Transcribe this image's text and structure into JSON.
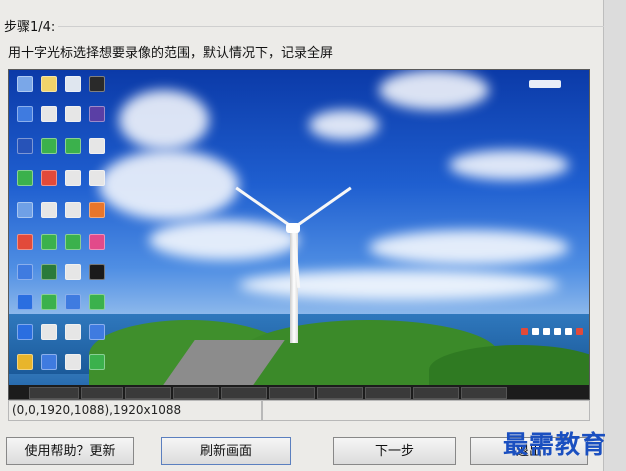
{
  "step": {
    "title": "步骤1/4:"
  },
  "instruction": "用十字光标选择想要录像的范围，默认情况下，记录全屏",
  "coordinates": "(0,0,1920,1088),1920x1088",
  "status": "",
  "buttons": {
    "help": "使用帮助？更新",
    "refresh": "刷新画面",
    "next": "下一步",
    "exit": "退出"
  },
  "watermark": "最需教育",
  "preview": {
    "description_icons": [
      "desktop-icon"
    ],
    "colors": {
      "sky": "#1f5fd0",
      "sea": "#2f78bd",
      "grass": "#3f8f2c",
      "taskbar": "#1c1c1c"
    }
  }
}
